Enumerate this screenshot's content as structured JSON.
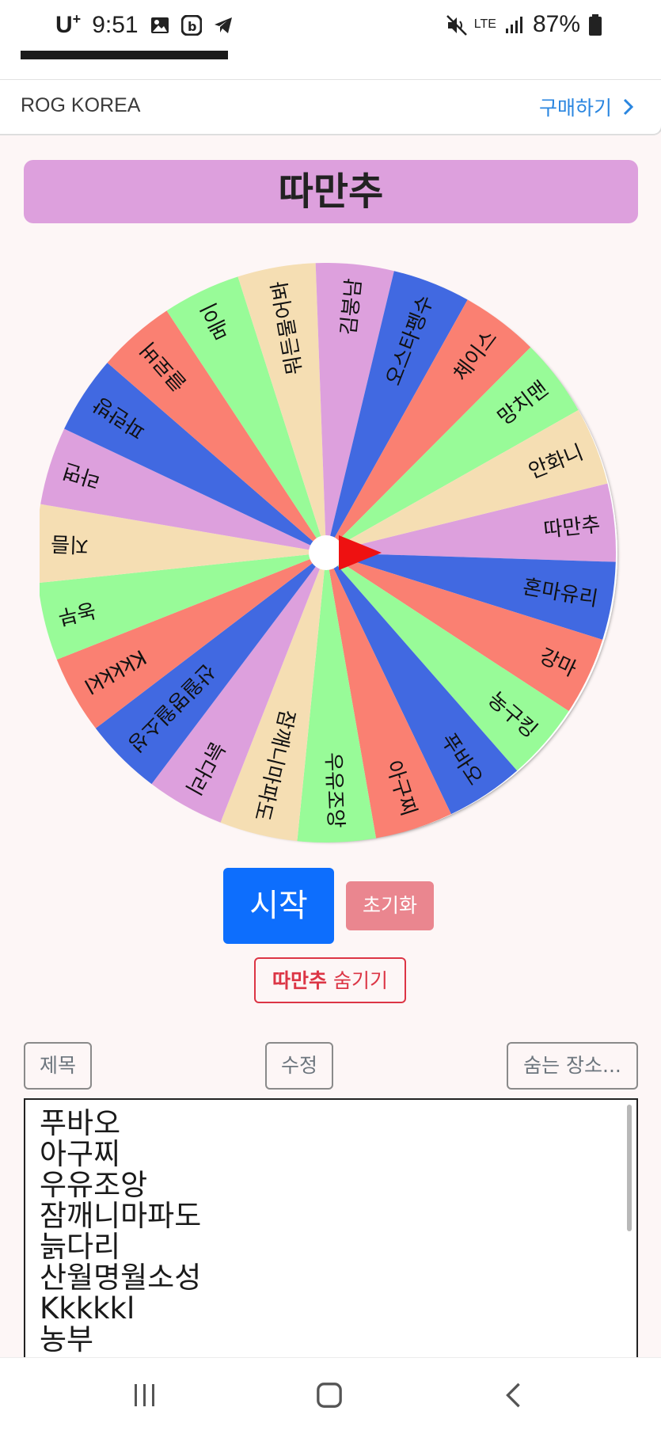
{
  "status_bar": {
    "carrier": "U",
    "time": "9:51",
    "network": "LTE",
    "battery": "87%"
  },
  "ad": {
    "brand": "ROG KOREA",
    "cta": "구매하기"
  },
  "title": "따만추",
  "wheel": {
    "segments": [
      {
        "label": "따만추",
        "color": "#dda0dd"
      },
      {
        "label": "혼마유리",
        "color": "#4169e1"
      },
      {
        "label": "강마",
        "color": "#fa8072"
      },
      {
        "label": "농구킹",
        "color": "#98fb98"
      },
      {
        "label": "푸바오",
        "color": "#4169e1"
      },
      {
        "label": "아구찌",
        "color": "#fa8072"
      },
      {
        "label": "우유조앙",
        "color": "#98fb98"
      },
      {
        "label": "잠깨니마파도",
        "color": "#f5deb3"
      },
      {
        "label": "늙다리",
        "color": "#dda0dd"
      },
      {
        "label": "산월명월소성",
        "color": "#4169e1"
      },
      {
        "label": "Kkkkkl",
        "color": "#fa8072"
      },
      {
        "label": "농부",
        "color": "#98fb98"
      },
      {
        "label": "지름",
        "color": "#f5deb3"
      },
      {
        "label": "라면",
        "color": "#dda0dd"
      },
      {
        "label": "파란방",
        "color": "#4169e1"
      },
      {
        "label": "클로버",
        "color": "#fa8072"
      },
      {
        "label": "메이",
        "color": "#98fb98"
      },
      {
        "label": "뭐든물어봐",
        "color": "#f5deb3"
      },
      {
        "label": "김붕남",
        "color": "#dda0dd"
      },
      {
        "label": "오스타펭수",
        "color": "#4169e1"
      },
      {
        "label": "체이스",
        "color": "#fa8072"
      },
      {
        "label": "망치맨",
        "color": "#98fb98"
      },
      {
        "label": "안화니",
        "color": "#f5deb3"
      }
    ]
  },
  "buttons": {
    "start": "시작",
    "reset": "초기화",
    "hide_prefix": "따만추",
    "hide_suffix": " 숨기기",
    "title": "제목",
    "edit": "수정",
    "hiding_place": "숨는 장소..."
  },
  "list": [
    "푸바오",
    "아구찌",
    "우유조앙",
    "잠깨니마파도",
    "늙다리",
    "산월명월소성",
    "Kkkkkl",
    "농부"
  ],
  "colors": {
    "primary": "#0d6efd",
    "danger": "#dc3545",
    "reset": "#ea868f",
    "title_bg": "#dda0dd",
    "pointer": "#ee1111"
  }
}
